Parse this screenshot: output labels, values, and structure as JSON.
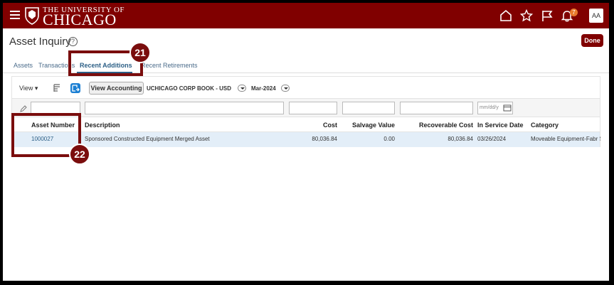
{
  "header": {
    "logo_top": "THE UNIVERSITY OF",
    "logo_main": "CHICAGO",
    "notification_count": "7",
    "avatar_initials": "AA",
    "brand_color": "#800000"
  },
  "page": {
    "title": "Asset Inquiry",
    "help_glyph": "?",
    "done_label": "Done"
  },
  "tabs": [
    {
      "label": "Assets"
    },
    {
      "label": "Transactions"
    },
    {
      "label": "Recent Additions",
      "active": true
    },
    {
      "label": "Recent Retirements"
    }
  ],
  "toolbar": {
    "view_label": "View ▾",
    "view_accounting_label": "View Accounting",
    "book": "UCHICAGO CORP BOOK - USD",
    "period": "Mar-2024"
  },
  "filters": {
    "date_placeholder": "mm/dd/y"
  },
  "table": {
    "columns": [
      "Asset Number",
      "Description",
      "Cost",
      "Salvage Value",
      "Recoverable Cost",
      "In Service Date",
      "Category"
    ],
    "rows": [
      {
        "asset_number": "1000027",
        "description": "Sponsored Constructed Equipment Merged Asset",
        "cost": "80,036.84",
        "salvage_value": "0.00",
        "recoverable_cost": "80,036.84",
        "in_service_date": "03/26/2024",
        "category": "Moveable Equipment-Fabr S"
      }
    ]
  },
  "annotations": [
    {
      "number": "21"
    },
    {
      "number": "22"
    }
  ]
}
